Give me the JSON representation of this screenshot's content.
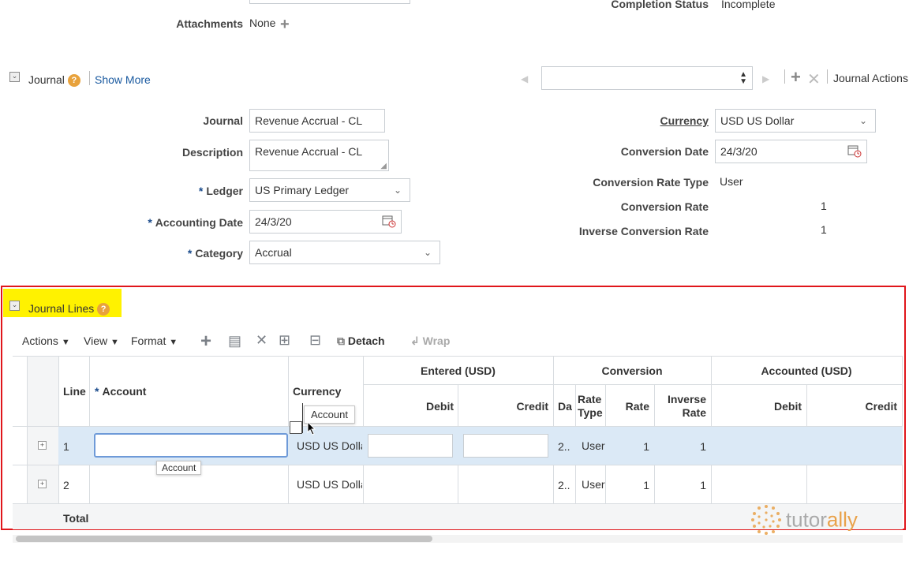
{
  "header": {
    "attachments_label": "Attachments",
    "attachments_value": "None",
    "completion_status_label": "Completion Status",
    "completion_status_value": "Incomplete"
  },
  "journal_section": {
    "title": "Journal",
    "show_more": "Show More",
    "journal_actions": "Journal Actions"
  },
  "form": {
    "journal_label": "Journal",
    "journal_value": "Revenue Accrual - CL",
    "description_label": "Description",
    "description_value": "Revenue Accrual - CL",
    "ledger_label": "Ledger",
    "ledger_value": "US Primary Ledger",
    "accounting_date_label": "Accounting Date",
    "accounting_date_value": "24/3/20",
    "category_label": "Category",
    "category_value": "Accrual",
    "currency_label": "Currency",
    "currency_value": "USD US Dollar",
    "conversion_date_label": "Conversion Date",
    "conversion_date_value": "24/3/20",
    "conversion_rate_type_label": "Conversion Rate Type",
    "conversion_rate_type_value": "User",
    "conversion_rate_label": "Conversion Rate",
    "conversion_rate_value": "1",
    "inverse_conversion_rate_label": "Inverse Conversion Rate",
    "inverse_conversion_rate_value": "1",
    "required_mark": "*"
  },
  "lines_section": {
    "title": "Journal Lines",
    "toolbar": {
      "actions": "Actions",
      "view": "View",
      "format": "Format",
      "detach": "Detach",
      "wrap": "Wrap"
    },
    "columns": {
      "line": "Line",
      "account": "Account",
      "currency": "Currency",
      "entered": "Entered (USD)",
      "debit": "Debit",
      "credit": "Credit",
      "conversion": "Conversion",
      "date_abbrev": "Da",
      "rate_type": "Rate Type",
      "rate": "Rate",
      "inverse_rate": "Inverse Rate",
      "accounted": "Accounted (USD)",
      "acc_debit": "Debit",
      "acc_credit": "Credit"
    },
    "rows": [
      {
        "line": "1",
        "currency": "USD US Dolla",
        "date": "2..",
        "rate_type": "User",
        "rate": "1",
        "inverse_rate": "1"
      },
      {
        "line": "2",
        "currency": "USD US Dolla",
        "date": "2..",
        "rate_type": "User",
        "rate": "1",
        "inverse_rate": "1"
      }
    ],
    "total_label": "Total",
    "tooltip_header": "Account",
    "tooltip_field": "Account"
  },
  "watermark": {
    "text_a": "tutor",
    "text_b": "ally"
  },
  "colors": {
    "highlight": "#fff200",
    "border_red": "#e0161b",
    "selected_row": "#dbe9f6",
    "link": "#1a5aa0",
    "watermark_orange": "#e9a24a"
  }
}
